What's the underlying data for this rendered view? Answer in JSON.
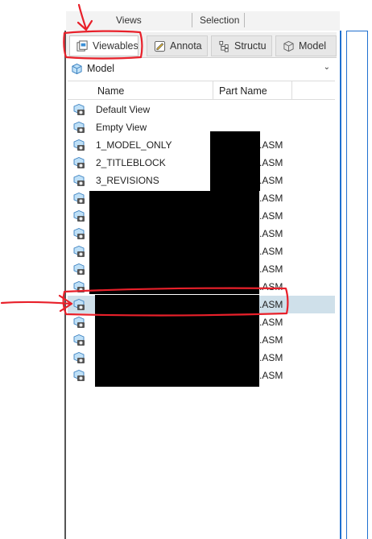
{
  "ribbon": {
    "views_label": "Views",
    "selection_label": "Selection"
  },
  "tabs": [
    {
      "label": "Viewables",
      "icon": "viewables-icon",
      "active": true
    },
    {
      "label": "Annota",
      "icon": "annotations-icon",
      "active": false
    },
    {
      "label": "Structu",
      "icon": "structure-icon",
      "active": false
    },
    {
      "label": "Model",
      "icon": "model-cube-icon",
      "active": false
    }
  ],
  "model_select": {
    "value": "Model",
    "icon": "model-cube-icon"
  },
  "columns": {
    "name": "Name",
    "part_name": "Part Name"
  },
  "rows": [
    {
      "name": "Default View",
      "part": ""
    },
    {
      "name": "Empty View",
      "part": ""
    },
    {
      "name": "1_MODEL_ONLY",
      "part": ".ASM"
    },
    {
      "name": "2_TITLEBLOCK",
      "part": ".ASM"
    },
    {
      "name": "3_REVISIONS",
      "part": ".ASM"
    },
    {
      "name": "",
      "part": ".ASM"
    },
    {
      "name": "",
      "part": ".ASM"
    },
    {
      "name": "",
      "part": ".ASM"
    },
    {
      "name": "",
      "part": ".ASM"
    },
    {
      "name": "",
      "part": ".ASM"
    },
    {
      "name": "",
      "part": ".ASM"
    },
    {
      "name": "",
      "part": ".ASM"
    },
    {
      "name": "",
      "part": ".ASM"
    },
    {
      "name": "",
      "part": ".ASM"
    },
    {
      "name": "",
      "part": ".ASM"
    },
    {
      "name": "",
      "part": ".ASM"
    }
  ],
  "selected_row_index": 11,
  "colors": {
    "selected_row": "#cfe0ea",
    "annotation_red": "#e8202a",
    "accent_blue": "#1f6fcf"
  }
}
